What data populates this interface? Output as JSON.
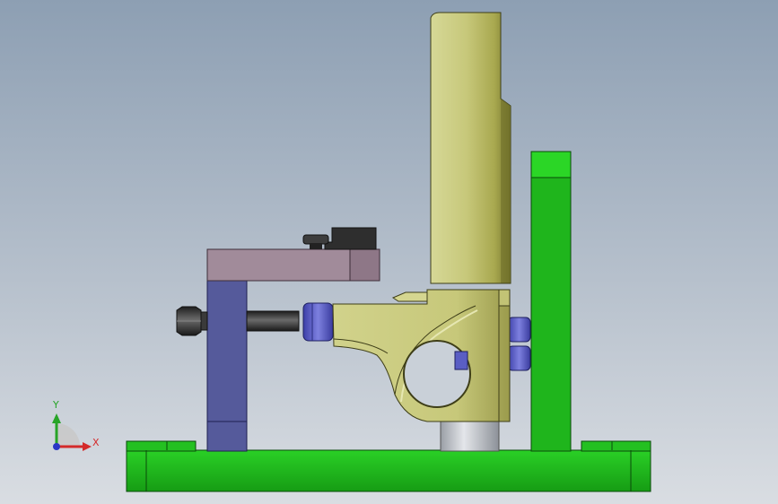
{
  "triad": {
    "y_label": "Y",
    "x_label": "X"
  },
  "colors": {
    "background_top": "#8d9fb3",
    "background_bottom": "#d9dde2",
    "base_plate": "#1fb51c",
    "base_plate_dark": "#158c14",
    "column_arm": "#c7c87a",
    "column_shade": "#7f7f36",
    "clamp_body": "#c8c87e",
    "support_block": "#555a9b",
    "top_arm": "#a18b9a",
    "bushing": "#5f62c8",
    "bolt": "#333333",
    "axis_y": "#27a427",
    "axis_x": "#d42a2a",
    "axis_z": "#2b36c6"
  }
}
